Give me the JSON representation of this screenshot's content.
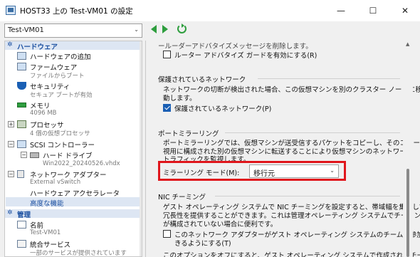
{
  "window": {
    "title": "HOST33 上の Test-VM01 の設定",
    "minimize_glyph": "—",
    "maximize_glyph": "☐",
    "close_glyph": "✕"
  },
  "toolbar": {
    "vm_selected": "Test-VM01",
    "dropdown_glyph": "⌄",
    "icons": [
      "back-arrow-icon",
      "forward-arrow-icon",
      "refresh-icon"
    ]
  },
  "tree": {
    "hardware_header": "ハードウェア",
    "management_header": "管理",
    "items": [
      {
        "label": "ハードウェアの追加",
        "sub": ""
      },
      {
        "label": "ファームウェア",
        "sub": "ファイルからブート"
      },
      {
        "label": "セキュリティ",
        "sub": "セキュア ブートが有効"
      },
      {
        "label": "メモリ",
        "sub": "4096 MB"
      },
      {
        "label": "プロセッサ",
        "sub": "4 個の仮想プロセッサ"
      },
      {
        "label": "SCSI コントローラー",
        "sub": ""
      },
      {
        "label": "ハード ドライブ",
        "sub": "Win2022_20240526.vhdx"
      },
      {
        "label": "ネットワーク アダプター",
        "sub": "External vSwitch"
      },
      {
        "label": "ハードウェア アクセラレータ",
        "sub": ""
      },
      {
        "label": "高度な機能",
        "sub": ""
      },
      {
        "label": "名前",
        "sub": "Test-VM01"
      },
      {
        "label": "統合サービス",
        "sub": "一部のサービスが提供されています"
      }
    ]
  },
  "content": {
    "top_cut_text": "ールーダーアドバタイズメッセージを削除します。",
    "router_guard_label": "ルーター アドバタイズ ガードを有効にする(R)",
    "protected_network": {
      "title": "保護されているネットワーク",
      "desc_line1": "ネットワークの切断が検出された場合、この仮想マシンを別のクラスター ノードに移",
      "desc_line2": "動します。",
      "checkbox_label": "保護されているネットワーク(P)"
    },
    "port_mirroring": {
      "title": "ポートミラーリング",
      "desc_line1": "ポートミラーリングでは、仮想マシンが送受信するパケットをコピーし、そのコピーを監",
      "desc_line2": "視用に構成された別の仮想マシンに転送することにより仮想マシンのネットワーク",
      "desc_line3": "トラフィックを監視します。",
      "mode_label": "ミラーリング モード(M):",
      "mode_value": "移行元"
    },
    "nic_teaming": {
      "title": "NIC チーミング",
      "desc_line1": "ゲスト オペレーティング システムで NIC チーミングを設定すると、帯域幅を集約して",
      "desc_line2": "冗長性を提供することができます。これは管理オペレーティング システムでチーミング",
      "desc_line3": "が構成されていない場合に便利です。",
      "checkbox_line1": "このネットワーク アダプターがゲスト オペレーティング システムのチームに参加で",
      "checkbox_line2": "きるようにする(T)",
      "bottom_cut_text": "このオプションをオフにすると、ゲスト オペレーティング システムで作成されたチーム"
    }
  },
  "colors": {
    "highlight_border": "#e0161c",
    "section_header_bg": "#dde6f3",
    "section_header_text": "#1a4fa0",
    "nav_green": "#2e9e3e"
  }
}
